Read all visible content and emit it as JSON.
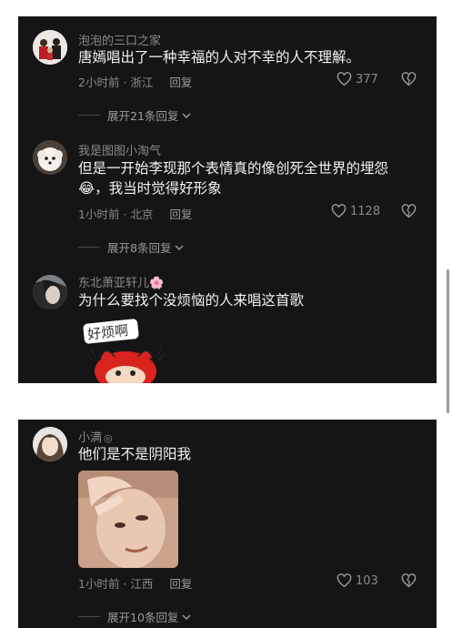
{
  "comments": [
    {
      "username": "泡泡的三口之家",
      "text": "唐嫣唱出了一种幸福的人对不幸的人不理解。",
      "time_location": "2小时前 · 浙江",
      "reply_label": "回复",
      "likes": "377",
      "expand_label": "展开21条回复"
    },
    {
      "username": "我是图图小淘气",
      "text_line1": "但是一开始李现那个表情真的像创死全世界的埋怨",
      "text_line2_emoji": "😂",
      "text_line2": "，我当时觉得好形象",
      "time_location": "1小时前 · 北京",
      "reply_label": "回复",
      "likes": "1128",
      "expand_label": "展开8条回复"
    },
    {
      "username": "东北萧亚轩儿",
      "username_emoji": "🌸",
      "text": "为什么要找个没烦恼的人来唱这首歌",
      "sticker_text": "好烦啊"
    },
    {
      "username": "小满",
      "text": "他们是不是阴阳我",
      "time_location": "1小时前 · 江西",
      "reply_label": "回复",
      "likes": "103",
      "expand_label": "展开10条回复"
    }
  ],
  "icons": {
    "like": "heart-outline-icon",
    "dislike": "heart-broken-icon",
    "expand": "chevron-down-icon"
  },
  "colors": {
    "panel_bg": "#151515",
    "text": "#f2f2f2",
    "muted": "#8a8a8a",
    "page_bg": "#ffffff"
  }
}
